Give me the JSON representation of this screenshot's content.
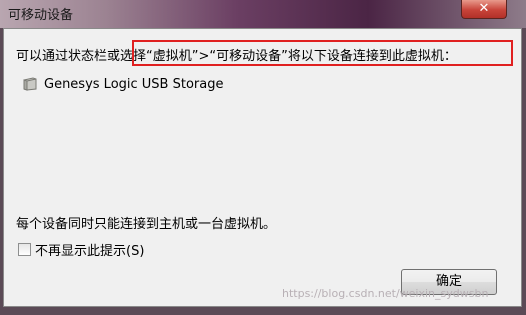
{
  "window": {
    "title": "可移动设备",
    "close_symbol": "✕"
  },
  "dialog": {
    "instruction": "可以通过状态栏或选择“虚拟机”>“可移动设备”将以下设备连接到此虚拟机：",
    "device_name": "Genesys Logic USB Storage",
    "note": "每个设备同时只能连接到主机或一台虚拟机。",
    "checkbox_label": "不再显示此提示(S)",
    "checkbox_checked": false,
    "ok_button": "确定"
  },
  "watermark": "https://blog.csdn.net/weixin_sydwsbn",
  "colors": {
    "highlight_border": "#e02020",
    "close_button": "#c8443a"
  },
  "icons": {
    "device": "usb-storage-icon",
    "close": "close-icon"
  }
}
